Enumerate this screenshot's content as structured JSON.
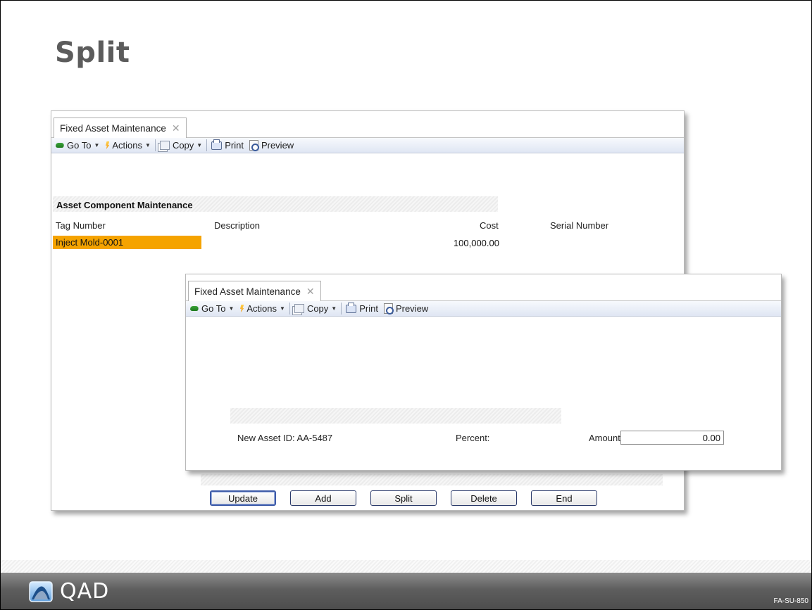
{
  "slide": {
    "title": "Split",
    "code": "FA-SU-850",
    "brand": "QAD"
  },
  "back_window": {
    "tab_label": "Fixed Asset Maintenance",
    "toolbar": {
      "goto_label": "Go To",
      "actions_label": "Actions",
      "copy_label": "Copy",
      "print_label": "Print",
      "preview_label": "Preview"
    },
    "section_title": "Asset Component Maintenance",
    "columns": [
      "Tag Number",
      "Description",
      "Cost",
      "Serial Number"
    ],
    "rows": [
      {
        "tag_number": "Inject Mold-0001",
        "description": "",
        "cost": "100,000.00",
        "serial_number": ""
      }
    ],
    "buttons": [
      "Update",
      "Add",
      "Split",
      "Delete",
      "End"
    ]
  },
  "front_window": {
    "tab_label": "Fixed Asset Maintenance",
    "toolbar": {
      "goto_label": "Go To",
      "actions_label": "Actions",
      "copy_label": "Copy",
      "print_label": "Print",
      "preview_label": "Preview"
    },
    "new_asset_label": "New Asset ID:",
    "new_asset_value": "AA-5487",
    "percent_label": "Percent:",
    "amount_label": "Amount:",
    "amount_value": "0.00"
  },
  "colors": {
    "selected_row": "#f5a300",
    "title_text": "#5c5c5c",
    "footer": "#5e5e5e"
  }
}
